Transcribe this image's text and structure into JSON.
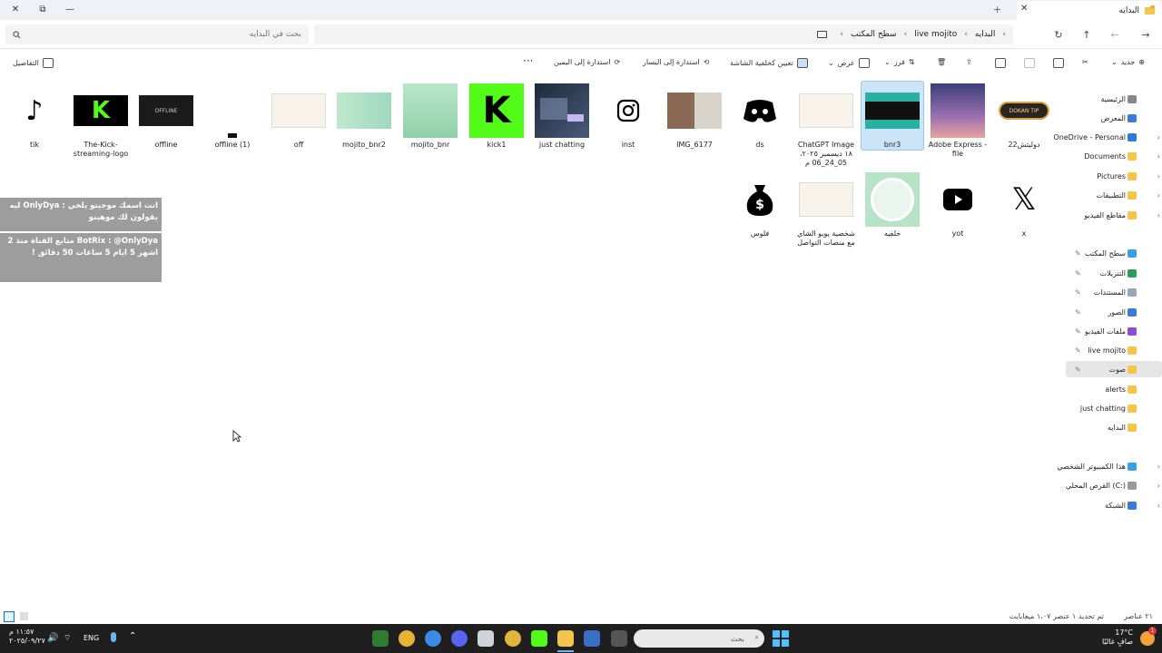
{
  "window": {
    "tab_title": "البدايه",
    "tab_close": "✕",
    "new_tab": "+",
    "controls": {
      "close": "✕",
      "restore": "⧉",
      "minimize": "—"
    }
  },
  "address": {
    "crumbs": [
      "البدايه",
      "live mojito",
      "سطح المكتب"
    ],
    "search_placeholder": "بحث في البدايه"
  },
  "toolbar": {
    "new_label": "جديد",
    "sort_label": "فرز",
    "view_label": "عرض",
    "set_wallpaper_label": "تعيين كخلفية الشاشة",
    "rotate_left_label": "استدارة إلى اليسار",
    "rotate_right_label": "استدارة إلى اليمين",
    "more_label": "···",
    "details_label": "التفاصيل"
  },
  "sidebar": {
    "items": [
      {
        "label": "الرئيسية",
        "icon": "home-icon",
        "chevron": false,
        "pinned": false
      },
      {
        "label": "المعرض",
        "icon": "gallery-icon",
        "chevron": false,
        "pinned": false
      },
      {
        "label": "OneDrive - Personal",
        "icon": "cloud-icon",
        "chevron": true,
        "pinned": false
      },
      {
        "label": "Documents",
        "icon": "folder-icon",
        "chevron": true,
        "pinned": false
      },
      {
        "label": "Pictures",
        "icon": "folder-icon",
        "chevron": true,
        "pinned": false
      },
      {
        "label": "التطبيقات",
        "icon": "folder-icon",
        "chevron": true,
        "pinned": false
      },
      {
        "label": "مقاطع الفيديو",
        "icon": "folder-icon",
        "chevron": true,
        "pinned": false
      },
      {
        "label": "سطح المكتب",
        "icon": "desktop-icon",
        "chevron": false,
        "pinned": true
      },
      {
        "label": "التنزيلات",
        "icon": "download-icon",
        "chevron": false,
        "pinned": true
      },
      {
        "label": "المستندات",
        "icon": "document-icon",
        "chevron": false,
        "pinned": true
      },
      {
        "label": "الصور",
        "icon": "pictures-icon",
        "chevron": false,
        "pinned": true
      },
      {
        "label": "ملفات الفيديو",
        "icon": "video-icon",
        "chevron": false,
        "pinned": true
      },
      {
        "label": "live mojito",
        "icon": "folder-icon",
        "chevron": false,
        "pinned": true
      },
      {
        "label": "صوت",
        "icon": "folder-icon",
        "chevron": false,
        "pinned": true
      },
      {
        "label": "alerts",
        "icon": "folder-icon",
        "chevron": false,
        "pinned": false
      },
      {
        "label": "just chatting",
        "icon": "folder-icon",
        "chevron": false,
        "pinned": false
      },
      {
        "label": "البدايه",
        "icon": "folder-icon",
        "chevron": false,
        "pinned": false
      },
      {
        "label": "هذا الكمبيوتر الشخصي",
        "icon": "pc-icon",
        "chevron": true,
        "pinned": false
      },
      {
        "label": "القرص المحلي (C:)",
        "icon": "drive-icon",
        "chevron": true,
        "pinned": false
      },
      {
        "label": "الشبكة",
        "icon": "network-icon",
        "chevron": true,
        "pinned": false
      }
    ]
  },
  "files": [
    {
      "name": "22دوليتش",
      "icon": "dokan-thumb-icon"
    },
    {
      "name": "Adobe Express - file",
      "icon": "gradient-thumb-icon"
    },
    {
      "name": "bnr3",
      "icon": "banner-thumb-icon"
    },
    {
      "name": "ChatGPT Image ١٨ ديسمبر ٢٠٢٥، 05_24_06 م",
      "icon": "card-thumb-icon"
    },
    {
      "name": "ds",
      "icon": "discord-icon"
    },
    {
      "name": "IMG_6177",
      "icon": "photo-thumb-icon"
    },
    {
      "name": "inst",
      "icon": "instagram-icon"
    },
    {
      "name": "just chatting",
      "icon": "chatting-thumb-icon"
    },
    {
      "name": "kick1",
      "icon": "kick-logo-icon"
    },
    {
      "name": "mojito_bnr",
      "icon": "mojito-thumb-icon"
    },
    {
      "name": "mojito_bnr2",
      "icon": "mojito-thumb-icon"
    },
    {
      "name": "off",
      "icon": "card-thumb-icon"
    },
    {
      "name": "offline (1)",
      "icon": "offline-small-icon"
    },
    {
      "name": "offline",
      "icon": "offline-thumb-icon"
    },
    {
      "name": "The-Kick-streaming-logo",
      "icon": "kick-logo-icon"
    },
    {
      "name": "tik",
      "icon": "tiktok-icon"
    },
    {
      "name": "x",
      "icon": "x-logo-icon"
    },
    {
      "name": "yot",
      "icon": "youtube-icon"
    },
    {
      "name": "خلفيه",
      "icon": "mascot-thumb-icon"
    },
    {
      "name": "شخصية يويو الشاي مع منصات التواصل",
      "icon": "card-thumb-icon"
    },
    {
      "name": "فلوس",
      "icon": "money-bag-icon"
    }
  ],
  "chat_overlay": {
    "line1_user": "OnlyDya",
    "line1_text": "انت اسمك موجيتو يلخي : OnlyDya ليه يقولون لك موهيتو",
    "line2_user": "BotRix",
    "line2_text": "BotRix : @OnlyDya متابع القناة منذ 2 اشهر 5 ايام 5 ساعات 50 دقائق !"
  },
  "status": {
    "count": "٢١ عناصر",
    "selection": "تم تحديد ١ عنصر ١،٠٧ ميغابايت"
  },
  "taskbar": {
    "weather_temp": "17°C",
    "weather_desc": "صافٍ غالبًا",
    "search_placeholder": "بحث",
    "lang": "ENG",
    "time": "١١:٥٧ م",
    "date": "٢٠٢٥/٠٩/٢٧",
    "weather_badge": "1"
  },
  "colors": {
    "accent": "#0078d4",
    "selection": "#cce4f7",
    "taskbar": "#1f1f1f",
    "kick_green": "#53fc18"
  }
}
